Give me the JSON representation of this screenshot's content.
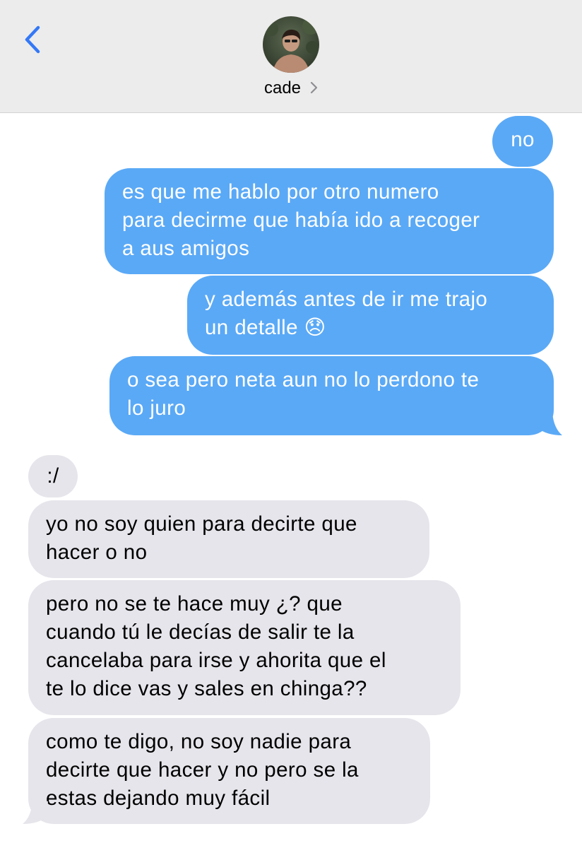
{
  "header": {
    "contact_name": "cade",
    "icons": {
      "back": "chevron-left-icon",
      "details": "chevron-right-icon",
      "avatar": "contact-avatar"
    }
  },
  "colors": {
    "header_bg": "#ececec",
    "outgoing_bubble": "#5aa9f6",
    "incoming_bubble": "#e6e5eb",
    "accent": "#3478f6"
  },
  "messages": [
    {
      "direction": "outgoing",
      "text": "no"
    },
    {
      "direction": "outgoing",
      "text": "es que me hablo por otro numero\npara decirme que había ido a recoger\na aus amigos"
    },
    {
      "direction": "outgoing",
      "text": "y además antes de ir me trajo\nun detalle 😞"
    },
    {
      "direction": "outgoing",
      "text": "o sea pero neta aun no lo perdono te\nlo juro"
    },
    {
      "direction": "incoming",
      "text": ":/"
    },
    {
      "direction": "incoming",
      "text": "yo no soy quien para decirte que\nhacer o no"
    },
    {
      "direction": "incoming",
      "text": "pero no se te hace muy ¿? que\ncuando tú le decías de salir te la\ncancelaba para irse y ahorita que el\nte lo dice vas y sales en chinga??"
    },
    {
      "direction": "incoming",
      "text": "como te digo, no soy nadie para\ndecirte que hacer y no pero se la\nestas dejando muy fácil"
    }
  ]
}
